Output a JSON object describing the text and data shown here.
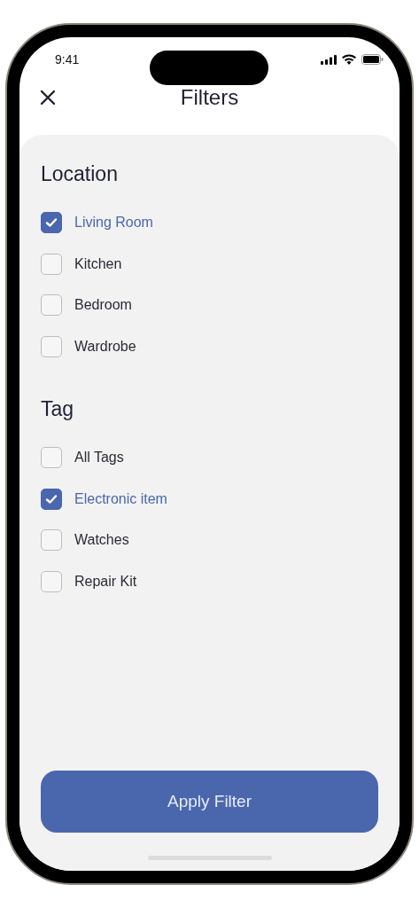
{
  "status_bar": {
    "time": "9:41"
  },
  "header": {
    "title": "Filters"
  },
  "sections": [
    {
      "title": "Location",
      "options": [
        {
          "label": "Living Room",
          "checked": true
        },
        {
          "label": "Kitchen",
          "checked": false
        },
        {
          "label": "Bedroom",
          "checked": false
        },
        {
          "label": "Wardrobe",
          "checked": false
        }
      ]
    },
    {
      "title": "Tag",
      "options": [
        {
          "label": "All Tags",
          "checked": false
        },
        {
          "label": "Electronic item",
          "checked": true
        },
        {
          "label": "Watches",
          "checked": false
        },
        {
          "label": "Repair Kit",
          "checked": false
        }
      ]
    }
  ],
  "apply_button": {
    "label": "Apply Filter"
  }
}
